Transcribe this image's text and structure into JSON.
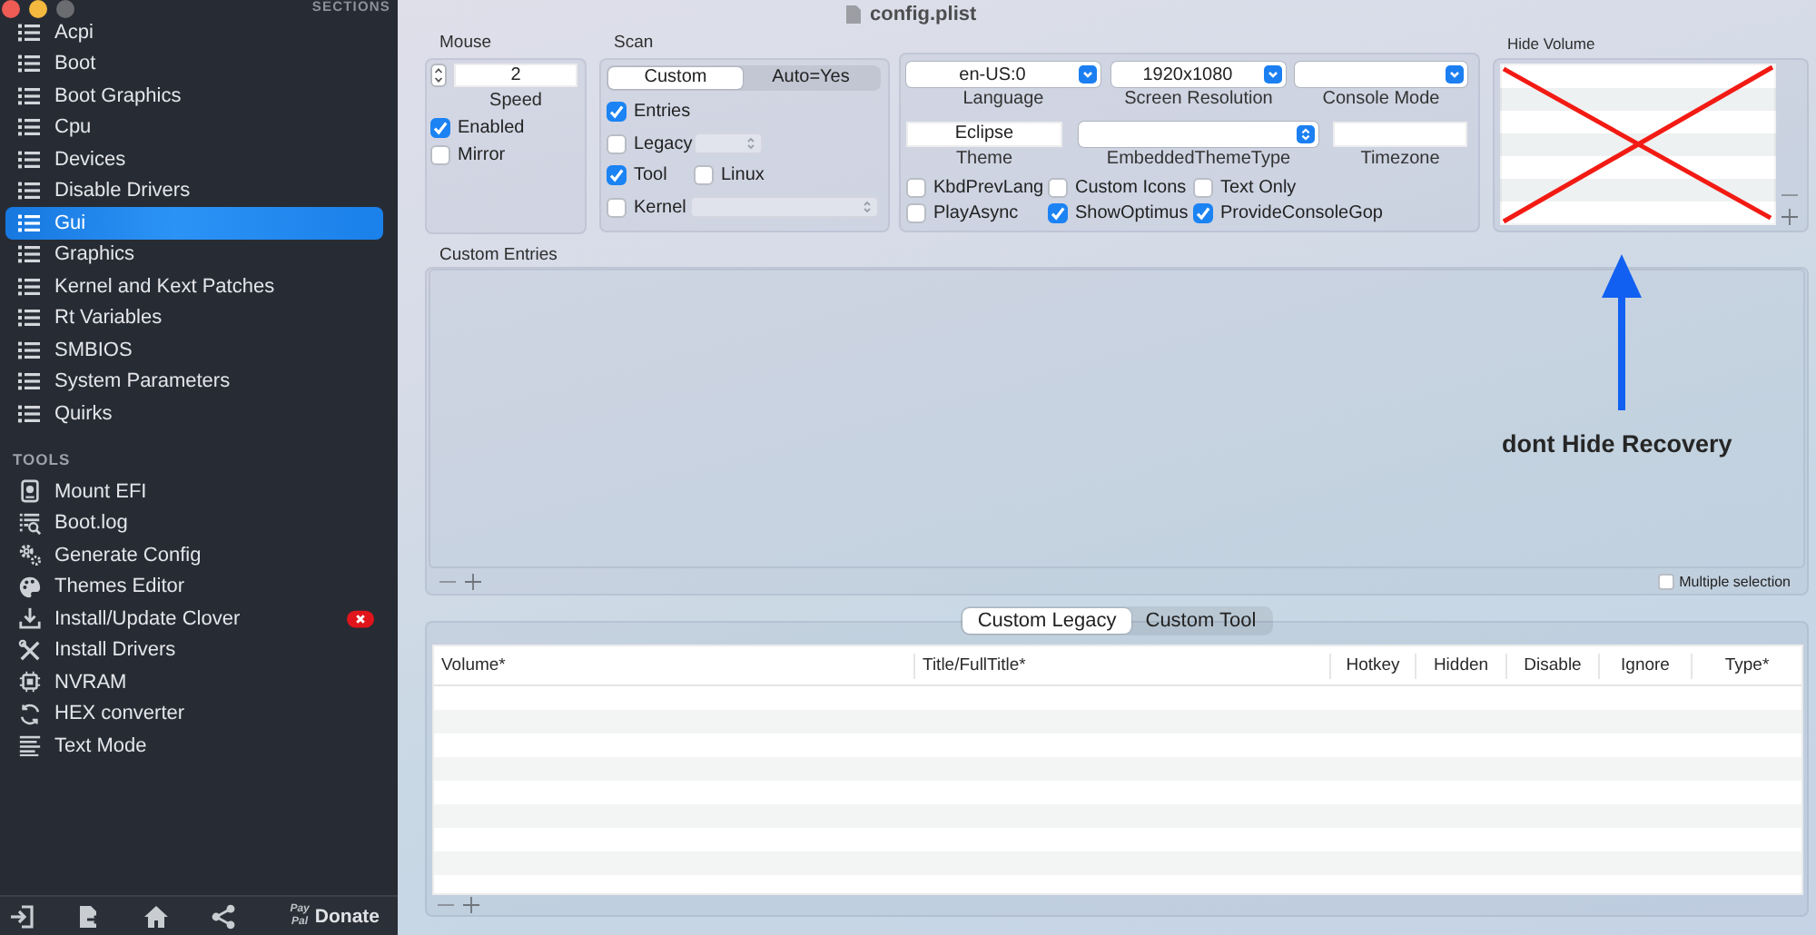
{
  "window": {
    "title": "config.plist",
    "controls": [
      {
        "color": "#ee5c55"
      },
      {
        "color": "#f4b93e"
      },
      {
        "color": "#6a6c70"
      }
    ]
  },
  "sidebar": {
    "sections_header": "SECTIONS",
    "sections": [
      {
        "label": "Acpi",
        "selected": false
      },
      {
        "label": "Boot",
        "selected": false
      },
      {
        "label": "Boot Graphics",
        "selected": false
      },
      {
        "label": "Cpu",
        "selected": false
      },
      {
        "label": "Devices",
        "selected": false
      },
      {
        "label": "Disable Drivers",
        "selected": false
      },
      {
        "label": "Gui",
        "selected": true
      },
      {
        "label": "Graphics",
        "selected": false
      },
      {
        "label": "Kernel and Kext Patches",
        "selected": false
      },
      {
        "label": "Rt Variables",
        "selected": false
      },
      {
        "label": "SMBIOS",
        "selected": false
      },
      {
        "label": "System Parameters",
        "selected": false
      },
      {
        "label": "Quirks",
        "selected": false
      }
    ],
    "tools_header": "TOOLS",
    "tools": [
      {
        "label": "Mount EFI",
        "error": false
      },
      {
        "label": "Boot.log",
        "error": false
      },
      {
        "label": "Generate Config",
        "error": false
      },
      {
        "label": "Themes Editor",
        "error": false
      },
      {
        "label": "Install/Update Clover",
        "error": true
      },
      {
        "label": "Install Drivers",
        "error": false
      },
      {
        "label": "NVRAM",
        "error": false
      },
      {
        "label": "HEX converter",
        "error": false
      },
      {
        "label": "Text Mode",
        "error": false
      }
    ],
    "donate": {
      "logo": [
        "Pay",
        "Pal"
      ],
      "label": "Donate"
    }
  },
  "mouse": {
    "title": "Mouse",
    "speed": {
      "value": "2",
      "label": "Speed"
    },
    "options": [
      {
        "label": "Enabled",
        "checked": true
      },
      {
        "label": "Mirror",
        "checked": false
      }
    ]
  },
  "scan": {
    "title": "Scan",
    "modes": [
      {
        "label": "Custom",
        "selected": true
      },
      {
        "label": "Auto=Yes",
        "selected": false
      }
    ],
    "rows": [
      {
        "items": [
          {
            "kind": "checkbox",
            "label": "Entries",
            "checked": true
          }
        ]
      },
      {
        "items": [
          {
            "kind": "checkbox",
            "label": "Legacy",
            "checked": false
          },
          {
            "kind": "popup"
          }
        ]
      },
      {
        "items": [
          {
            "kind": "checkbox",
            "label": "Tool",
            "checked": true
          },
          {
            "kind": "checkbox",
            "label": "Linux",
            "checked": false
          }
        ]
      },
      {
        "items": [
          {
            "kind": "checkbox",
            "label": "Kernel",
            "checked": false
          },
          {
            "kind": "popup"
          }
        ]
      }
    ]
  },
  "display": {
    "rows": [
      {
        "fields": [
          {
            "kind": "popup",
            "value": "en-US:0",
            "label": "Language"
          },
          {
            "kind": "popup",
            "value": "1920x1080",
            "label": "Screen Resolution"
          },
          {
            "kind": "popup",
            "label": "Console Mode"
          }
        ]
      },
      {
        "fields": [
          {
            "kind": "field",
            "value": "Eclipse",
            "label": "Theme"
          },
          {
            "kind": "stepper",
            "label": "EmbeddedThemeType"
          },
          {
            "kind": "field",
            "label": "Timezone"
          }
        ]
      }
    ],
    "options": [
      {
        "label": "KbdPrevLang",
        "checked": false
      },
      {
        "label": "Custom Icons",
        "checked": false
      },
      {
        "label": "Text Only",
        "checked": false
      },
      {
        "label": "PlayAsync",
        "checked": false
      },
      {
        "label": "ShowOptimus",
        "checked": true
      },
      {
        "label": "ProvideConsoleGop",
        "checked": true
      }
    ]
  },
  "hide_volume": {
    "title": "Hide Volume"
  },
  "annotation": {
    "text": "dont Hide Recovery"
  },
  "custom_entries": {
    "title": "Custom Entries",
    "multiple_selection": {
      "label": "Multiple selection",
      "checked": false
    }
  },
  "custom_tabs": [
    {
      "label": "Custom Legacy",
      "selected": true
    },
    {
      "label": "Custom Tool",
      "selected": false
    }
  ],
  "table": {
    "columns": [
      "Volume*",
      "Title/FullTitle*",
      "Hotkey",
      "Hidden",
      "Disable",
      "Ignore",
      "Type*"
    ]
  }
}
